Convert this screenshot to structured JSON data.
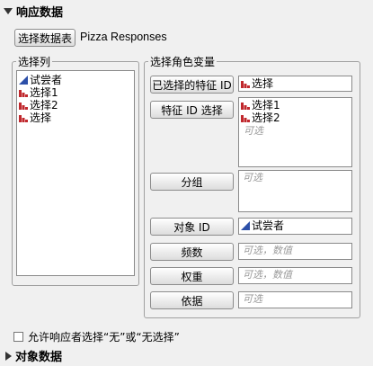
{
  "response_section": {
    "title": "响应数据"
  },
  "select_table_button": "选择数据表",
  "table_name": "Pizza Responses",
  "select_columns": {
    "title": "选择列",
    "items": [
      {
        "label": "试尝者",
        "icon": "continuous-icon"
      },
      {
        "label": "选择1",
        "icon": "nominal-icon"
      },
      {
        "label": "选择2",
        "icon": "nominal-icon"
      },
      {
        "label": "选择",
        "icon": "nominal-icon"
      }
    ]
  },
  "roles": {
    "title": "选择角色变量",
    "chosen_feature_id": {
      "button": "已选择的特征 ID",
      "value": "选择"
    },
    "feature_id_choice": {
      "button": "特征 ID 选择",
      "values": [
        "选择1",
        "选择2"
      ],
      "placeholder": "可选"
    },
    "grouping": {
      "button": "分组",
      "placeholder": "可选"
    },
    "subject_id": {
      "button": "对象 ID",
      "value": "试尝者"
    },
    "freq": {
      "button": "频数",
      "placeholder": "可选，数值"
    },
    "weight": {
      "button": "权重",
      "placeholder": "可选，数值"
    },
    "by": {
      "button": "依据",
      "placeholder": "可选"
    }
  },
  "allow_none_label": "允许响应者选择“无”或“无选择”",
  "subject_section": {
    "title": "对象数据"
  },
  "colors": {
    "nominal": "#c0282d",
    "continuous": "#2c4fa8"
  }
}
